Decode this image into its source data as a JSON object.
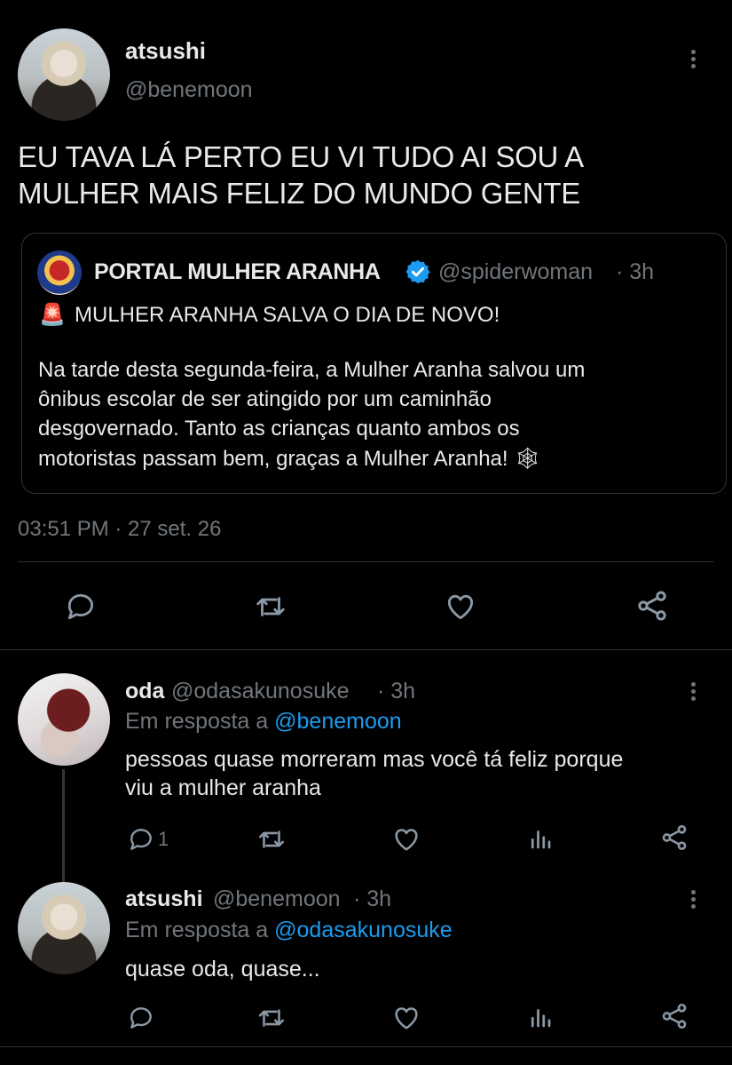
{
  "main_tweet": {
    "display_name": "atsushi",
    "handle": "@benemoon",
    "text_line1": "EU TAVA LÁ PERTO EU VI TUDO AI SOU A",
    "text_line2": "MULHER MAIS FELIZ DO MUNDO GENTE",
    "timestamp": "03:51 PM · 27 set. 26"
  },
  "quoted_tweet": {
    "display_name": "PORTAL MULHER ARANHA",
    "handle": "@spiderwoman",
    "time": "· 3h",
    "headline_emoji": "🚨",
    "headline": "MULHER ARANHA SALVA O DIA DE NOVO!",
    "body_line1": "Na tarde desta segunda-feira, a Mulher Aranha salvou um",
    "body_line2": "ônibus escolar de ser atingido por um caminhão",
    "body_line3": "desgovernado. Tanto as crianças quanto ambos os",
    "body_line4": "motoristas passam bem, graças a Mulher Aranha! 🕸"
  },
  "replies": [
    {
      "display_name": "oda",
      "handle": "@odasakunosuke",
      "time": "· 3h",
      "reply_prefix": "Em resposta a",
      "reply_to": "@benemoon",
      "text_line1": "pessoas quase morreram mas você tá feliz porque",
      "text_line2": "viu a mulher aranha",
      "reply_count": "1"
    },
    {
      "display_name": "atsushi",
      "handle": "@benemoon",
      "time": "· 3h",
      "reply_prefix": "Em resposta a",
      "reply_to": "@odasakunosuke",
      "text_line1": "quase oda, quase...",
      "reply_count": ""
    }
  ],
  "colors": {
    "background": "#000000",
    "text": "#e7e9ea",
    "muted": "#71767b",
    "link": "#1d9bf0",
    "divider": "#2f3336"
  },
  "icons": [
    "more-icon",
    "reply-icon",
    "retweet-icon",
    "like-icon",
    "share-icon",
    "analytics-icon",
    "verified-badge-icon",
    "siren-icon",
    "spiderweb-icon"
  ]
}
